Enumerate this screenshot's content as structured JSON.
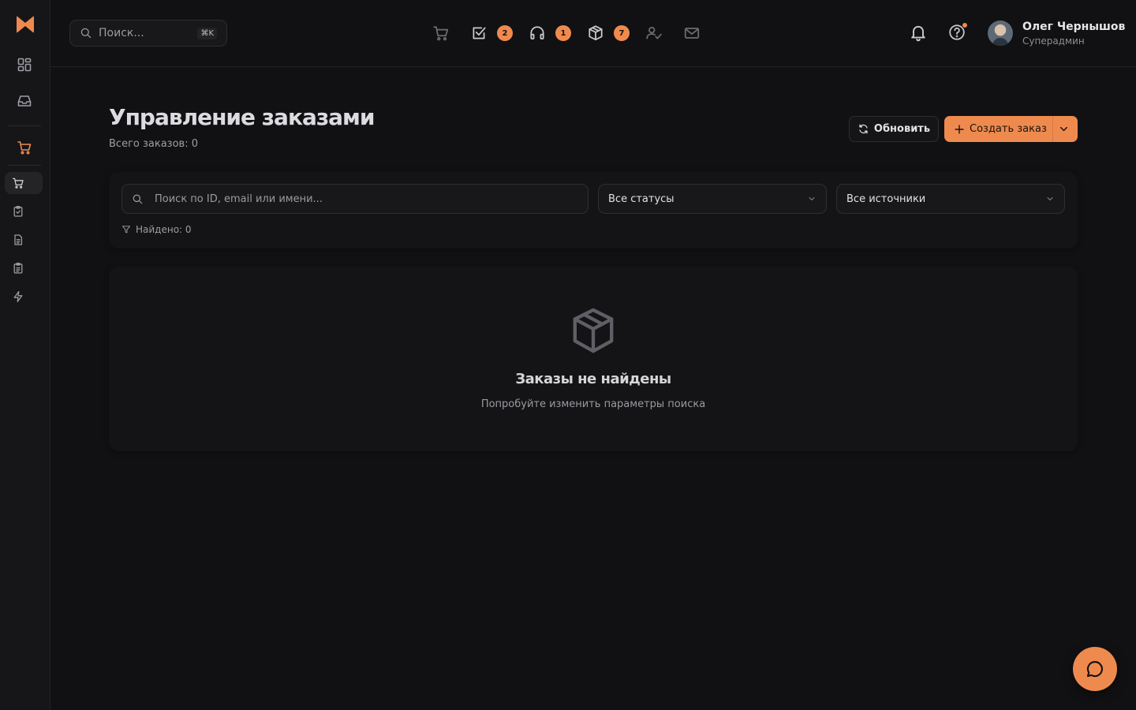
{
  "sidebar": {
    "logo": "x-logo-icon",
    "items": [
      {
        "icon": "dashboard-icon"
      },
      {
        "icon": "inbox-icon"
      },
      {
        "icon": "cart-icon"
      },
      {
        "icon": "cart-icon"
      },
      {
        "icon": "clipboard-check-icon"
      },
      {
        "icon": "document-icon"
      },
      {
        "icon": "clipboard-list-icon"
      },
      {
        "icon": "lightning-icon"
      }
    ]
  },
  "header": {
    "search_placeholder": "Поиск...",
    "search_shortcut": "⌘K",
    "quick_icons": [
      {
        "icon": "cart-icon",
        "badge": ""
      },
      {
        "icon": "checkbox-icon",
        "badge": "2"
      },
      {
        "icon": "headphones-icon",
        "badge": "1"
      },
      {
        "icon": "package-icon",
        "badge": "7"
      },
      {
        "icon": "user-check-icon",
        "badge": ""
      },
      {
        "icon": "mail-icon",
        "badge": ""
      }
    ],
    "user": {
      "name": "Олег Чернышов",
      "role": "Суперадмин"
    }
  },
  "page": {
    "title": "Управление заказами",
    "subtitle": "Всего заказов: 0",
    "refresh_label": "Обновить",
    "create_label": "Создать заказ"
  },
  "filters": {
    "search_placeholder": "Поиск по ID, email или имени...",
    "status_value": "Все статусы",
    "source_value": "Все источники",
    "found_text": "Найдено: 0"
  },
  "empty": {
    "title": "Заказы не найдены",
    "subtitle": "Попробуйте изменить параметры поиска"
  },
  "colors": {
    "accent": "#ef8a4f",
    "background": "#111113",
    "surface": "#141416"
  }
}
